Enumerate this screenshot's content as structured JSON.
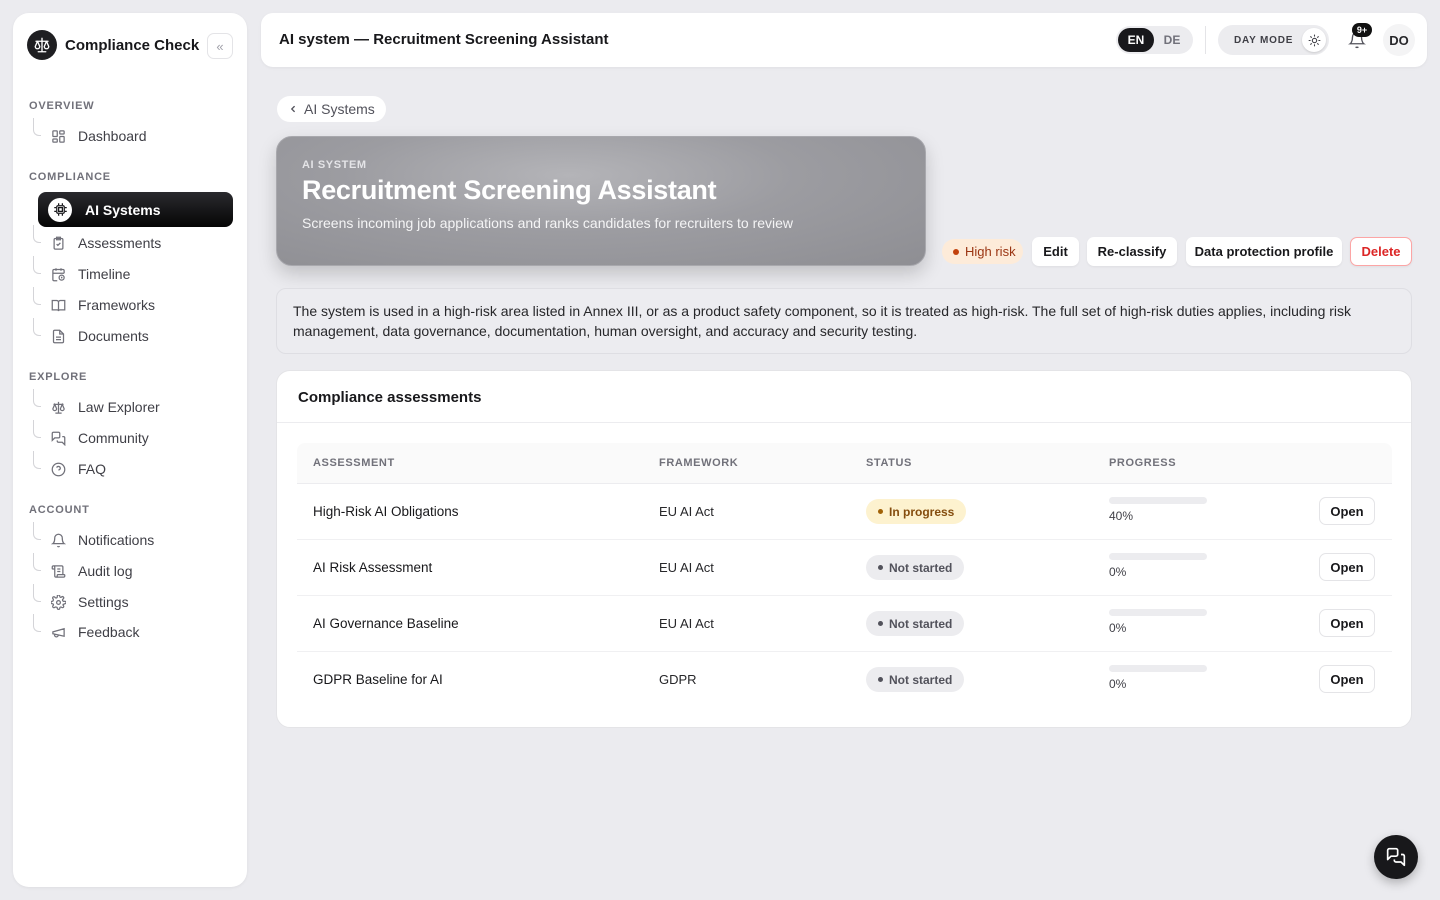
{
  "app": {
    "name": "Compliance Check",
    "collapse_glyph": "«"
  },
  "sidebar": {
    "sections": {
      "overview": "OVERVIEW",
      "compliance": "COMPLIANCE",
      "explore": "EXPLORE",
      "account": "ACCOUNT"
    },
    "items": {
      "dashboard": "Dashboard",
      "ai_systems": "AI Systems",
      "assessments": "Assessments",
      "timeline": "Timeline",
      "frameworks": "Frameworks",
      "documents": "Documents",
      "law_explorer": "Law Explorer",
      "community": "Community",
      "faq": "FAQ",
      "notifications": "Notifications",
      "audit_log": "Audit log",
      "settings": "Settings",
      "feedback": "Feedback"
    },
    "active_item": "ai_systems"
  },
  "header": {
    "title": "AI system — Recruitment Screening Assistant",
    "languages": [
      "EN",
      "DE"
    ],
    "active_language": "EN",
    "theme_label": "DAY MODE",
    "notification_badge": "9+",
    "avatar_initials": "DO"
  },
  "breadcrumb": {
    "back_label": "AI Systems"
  },
  "hero": {
    "kicker": "AI SYSTEM",
    "title": "Recruitment Screening Assistant",
    "description": "Screens incoming job applications and ranks candidates for recruiters to review"
  },
  "actions": {
    "risk_label": "High risk",
    "edit": "Edit",
    "reclassify": "Re-classify",
    "data_protection": "Data protection profile",
    "delete": "Delete"
  },
  "info_text": "The system is used in a high-risk area listed in Annex III, or as a product safety component, so it is treated as high-risk. The full set of high-risk duties applies, including risk management, data governance, documentation, human oversight, and accuracy and security testing.",
  "assessments": {
    "title": "Compliance assessments",
    "columns": [
      "ASSESSMENT",
      "FRAMEWORK",
      "STATUS",
      "PROGRESS"
    ],
    "open_label": "Open",
    "rows": [
      {
        "name": "High-Risk AI Obligations",
        "framework": "EU AI Act",
        "status": "In progress",
        "progress": 40,
        "progress_label": "40%"
      },
      {
        "name": "AI Risk Assessment",
        "framework": "EU AI Act",
        "status": "Not started",
        "progress": 0,
        "progress_label": "0%"
      },
      {
        "name": "AI Governance Baseline",
        "framework": "EU AI Act",
        "status": "Not started",
        "progress": 0,
        "progress_label": "0%"
      },
      {
        "name": "GDPR Baseline for AI",
        "framework": "GDPR",
        "status": "Not started",
        "progress": 0,
        "progress_label": "0%"
      }
    ]
  },
  "colors": {
    "accent_dark": "#18181b",
    "risk_bg": "#fdebd9",
    "risk_text": "#9a3412",
    "progress_fill": "#b45309",
    "danger": "#dc2626"
  }
}
